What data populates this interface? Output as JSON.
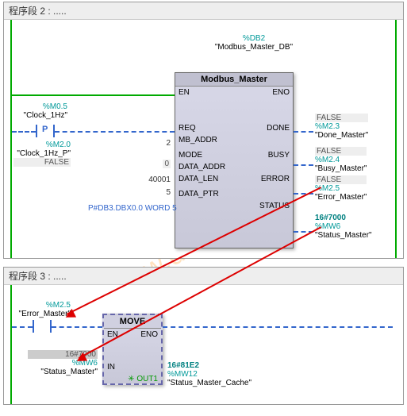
{
  "watermark": "www.dataie.com",
  "network2": {
    "title": "程序段 2 :   .....",
    "instance_db_addr": "%DB2",
    "instance_db_sym": "\"Modbus_Master_DB\"",
    "fb_name": "Modbus_Master",
    "en": "EN",
    "eno": "ENO",
    "ports_in": [
      "REQ",
      "MB_ADDR",
      "MODE",
      "DATA_ADDR",
      "DATA_LEN",
      "DATA_PTR"
    ],
    "ports_out": [
      "DONE",
      "BUSY",
      "ERROR",
      "STATUS"
    ],
    "req_addr": "%M0.5",
    "req_sym": "\"Clock_1Hz\"",
    "req_mem_addr": "%M2.0",
    "req_mem_sym": "\"Clock_1Hz_P\"",
    "req_mem_val": "FALSE",
    "mb_addr_val": "2",
    "mode_val": "0",
    "data_addr_val": "40001",
    "data_len_val": "5",
    "data_ptr_val": "P#DB3.DBX0.0 WORD 5",
    "done_val": "FALSE",
    "done_addr": "%M2.3",
    "done_sym": "\"Done_Master\"",
    "busy_val": "FALSE",
    "busy_addr": "%M2.4",
    "busy_sym": "\"Busy_Master\"",
    "error_val": "FALSE",
    "error_addr": "%M2.5",
    "error_sym": "\"Error_Master\"",
    "status_val": "16#7000",
    "status_addr": "%MW6",
    "status_sym": "\"Status_Master\""
  },
  "network3": {
    "title": "程序段 3 :   .....",
    "fb_name": "MOVE",
    "en": "EN",
    "eno": "ENO",
    "in": "IN",
    "out": "OUT1",
    "en_addr": "%M2.5",
    "en_sym": "\"Error_Master\"",
    "in_val": "16#7000",
    "in_addr": "%MW6",
    "in_sym": "\"Status_Master\"",
    "out_val": "16#81E2",
    "out_addr": "%MW12",
    "out_sym": "\"Status_Master_Cache\""
  }
}
